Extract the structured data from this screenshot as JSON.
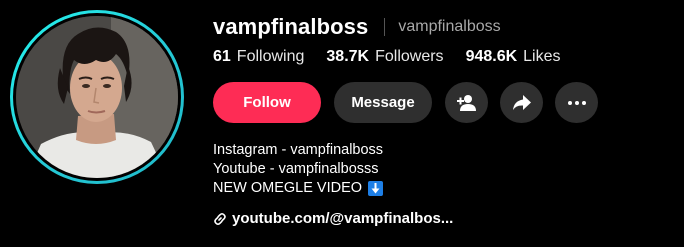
{
  "profile": {
    "display_name": "vampfinalboss",
    "handle": "vampfinalboss",
    "avatar_ring_color": "#25f4ee"
  },
  "stats": [
    {
      "value": "61",
      "label": "Following"
    },
    {
      "value": "38.7K",
      "label": "Followers"
    },
    {
      "value": "948.6K",
      "label": "Likes"
    }
  ],
  "actions": {
    "follow_label": "Follow",
    "message_label": "Message",
    "follow_color": "#fe2c55",
    "icons": [
      "add-friend-icon",
      "share-icon",
      "more-icon"
    ]
  },
  "bio": {
    "lines": [
      "Instagram - vampfinalboss",
      "Youtube - vampfinalbosss",
      "NEW OMEGLE VIDEO"
    ],
    "badge_icon": "down-arrow-icon"
  },
  "link": {
    "text": "youtube.com/@vampfinalbos...",
    "icon": "link-icon"
  }
}
